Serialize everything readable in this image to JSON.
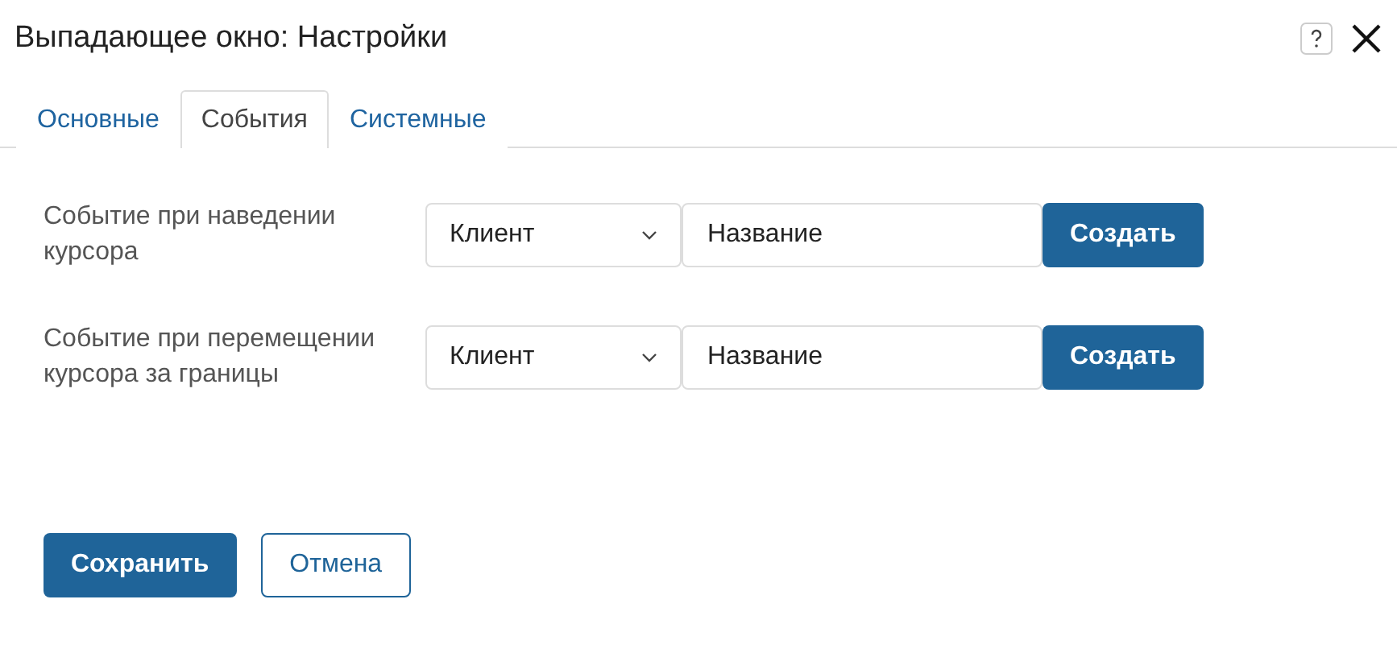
{
  "window": {
    "title": "Выпадающее окно: Настройки"
  },
  "tabs": [
    {
      "label": "Основные",
      "selected": false
    },
    {
      "label": "События",
      "selected": true
    },
    {
      "label": "Системные",
      "selected": false
    }
  ],
  "events": [
    {
      "label": "Событие при наведении курсора",
      "select": "Клиент",
      "name": "Название",
      "button": "Создать"
    },
    {
      "label": "Событие при перемещении курсора за границы",
      "select": "Клиент",
      "name": "Название",
      "button": "Создать"
    }
  ],
  "buttons": {
    "save": "Сохранить",
    "cancel": "Отмена"
  }
}
